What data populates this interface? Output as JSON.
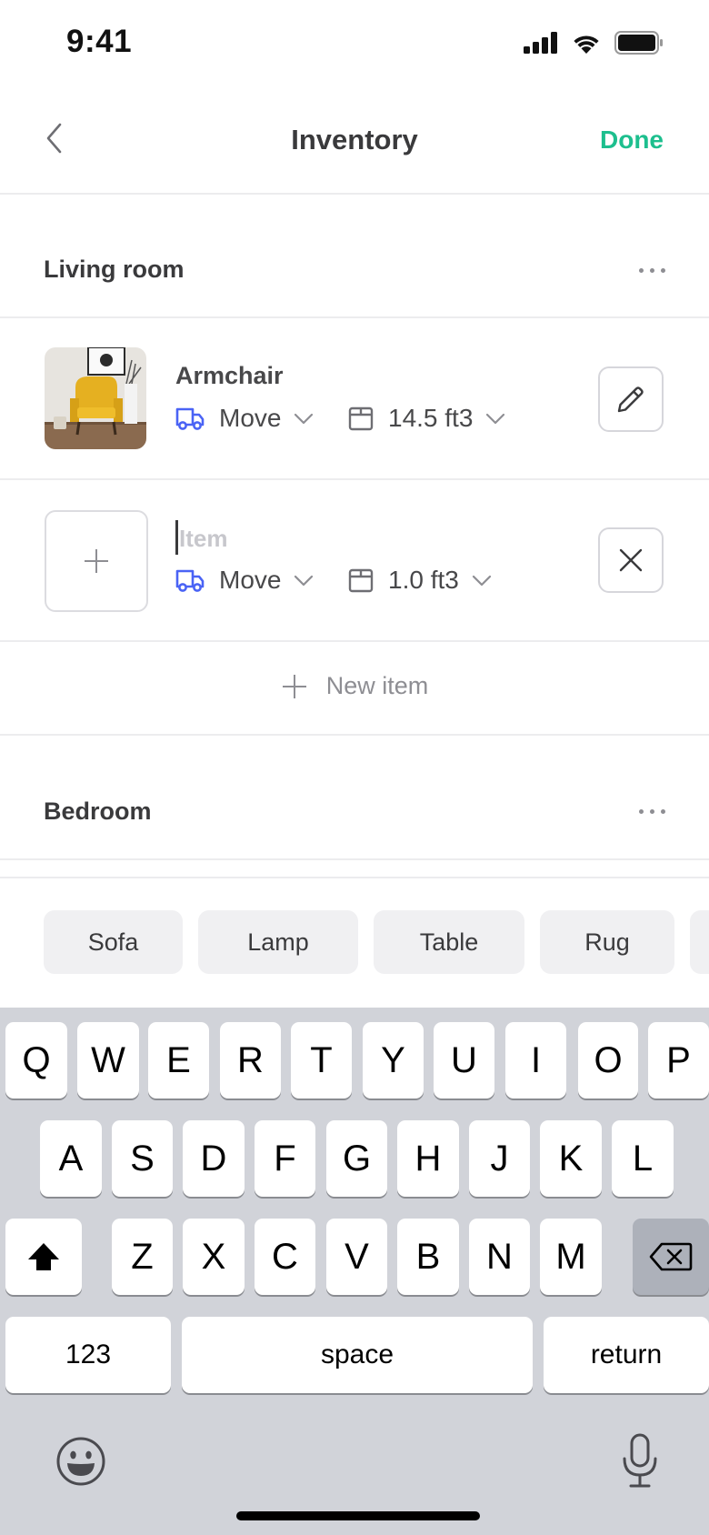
{
  "status_bar": {
    "time": "9:41"
  },
  "nav": {
    "title": "Inventory",
    "done_label": "Done",
    "accent_color": "#1dbf8e"
  },
  "sections": [
    {
      "title": "Living room",
      "items": [
        {
          "name": "Armchair",
          "action": "Move",
          "volume": "14.5 ft3",
          "has_photo": true,
          "button_icon": "pencil-icon"
        },
        {
          "name": "",
          "placeholder": "Item",
          "action": "Move",
          "volume": "1.0 ft3",
          "has_photo": false,
          "button_icon": "close-icon"
        }
      ],
      "new_item_label": "New item"
    },
    {
      "title": "Bedroom"
    }
  ],
  "suggestions": [
    "Sofa",
    "Lamp",
    "Table",
    "Rug"
  ],
  "keyboard": {
    "row1": [
      "Q",
      "W",
      "E",
      "R",
      "T",
      "Y",
      "U",
      "I",
      "O",
      "P"
    ],
    "row2": [
      "A",
      "S",
      "D",
      "F",
      "G",
      "H",
      "J",
      "K",
      "L"
    ],
    "row3": [
      "Z",
      "X",
      "C",
      "V",
      "B",
      "N",
      "M"
    ],
    "numbers_label": "123",
    "space_label": "space",
    "return_label": "return"
  },
  "colors": {
    "truck_icon": "#4a63f5",
    "divider": "#ececee"
  }
}
